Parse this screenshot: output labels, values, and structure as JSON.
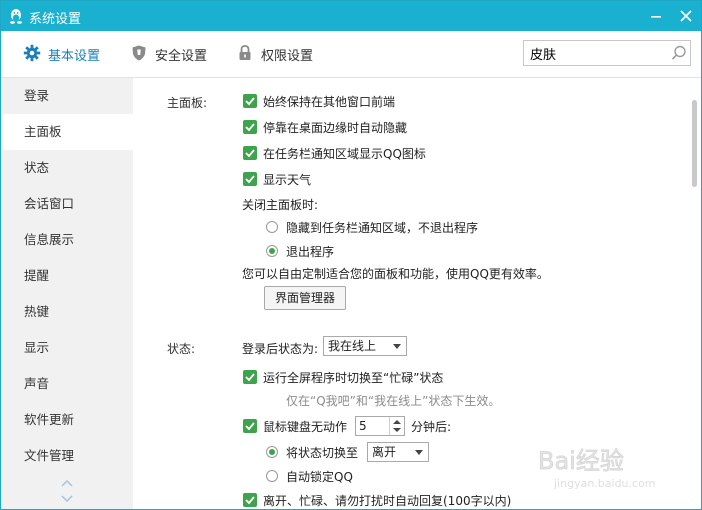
{
  "window": {
    "title": "系统设置"
  },
  "toolbar": {
    "tabs": [
      {
        "label": "基本设置",
        "icon": "gear-icon"
      },
      {
        "label": "安全设置",
        "icon": "shield-icon"
      },
      {
        "label": "权限设置",
        "icon": "lock-icon"
      }
    ],
    "search": {
      "value": "皮肤",
      "icon": "search-icon"
    }
  },
  "sidebar": {
    "items": [
      "登录",
      "主面板",
      "状态",
      "会话窗口",
      "信息展示",
      "提醒",
      "热键",
      "显示",
      "声音",
      "软件更新",
      "文件管理"
    ],
    "active": "主面板"
  },
  "main_panel": {
    "label": "主面板:",
    "checkboxes": [
      "始终保持在其他窗口前端",
      "停靠在桌面边缘时自动隐藏",
      "在任务栏通知区域显示QQ图标",
      "显示天气"
    ],
    "close_label": "关闭主面板时:",
    "close_options": [
      "隐藏到任务栏通知区域，不退出程序",
      "退出程序"
    ],
    "close_selected": "退出程序",
    "customize_text": "您可以自由定制适合您的面板和功能，使用QQ更有效率。",
    "manager_button": "界面管理器"
  },
  "status": {
    "label": "状态:",
    "login_status_label": "登录后状态为:",
    "login_status_value": "我在线上",
    "fullscreen_busy": "运行全屏程序时切换至“忙碌”状态",
    "fullscreen_hint": "仅在“Q我吧”和“我在线上”状态下生效。",
    "idle_label": "鼠标键盘无动作",
    "idle_minutes": "5",
    "idle_suffix": "分钟后:",
    "switch_label": "将状态切换至",
    "switch_value": "离开",
    "lock_label": "自动锁定QQ",
    "auto_reply": "离开、忙碌、请勿打扰时自动回复(100字以内)"
  },
  "watermark": {
    "text": "Bai经验",
    "sub": "jingyan.baidu.com"
  },
  "colors": {
    "titlebar": "#1ab0cf",
    "check": "#3fa34d",
    "accent": "#1a7fb8"
  }
}
